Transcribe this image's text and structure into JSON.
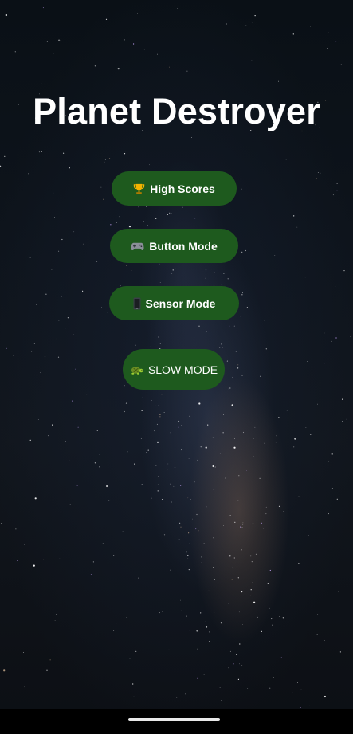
{
  "game": {
    "title": "Planet Destroyer"
  },
  "menu": {
    "high_scores": {
      "label": "High Scores",
      "icon": "trophy-icon"
    },
    "button_mode": {
      "label": "Button Mode",
      "icon": "gamepad-icon"
    },
    "sensor_mode": {
      "label": "Sensor Mode",
      "icon": "phone-icon"
    },
    "slow_mode": {
      "label": "SLOW MODE",
      "icon": "turtle-icon"
    }
  },
  "colors": {
    "button_bg": "#1e5a1e",
    "title_text": "#ffffff",
    "background": "#0e141c"
  }
}
